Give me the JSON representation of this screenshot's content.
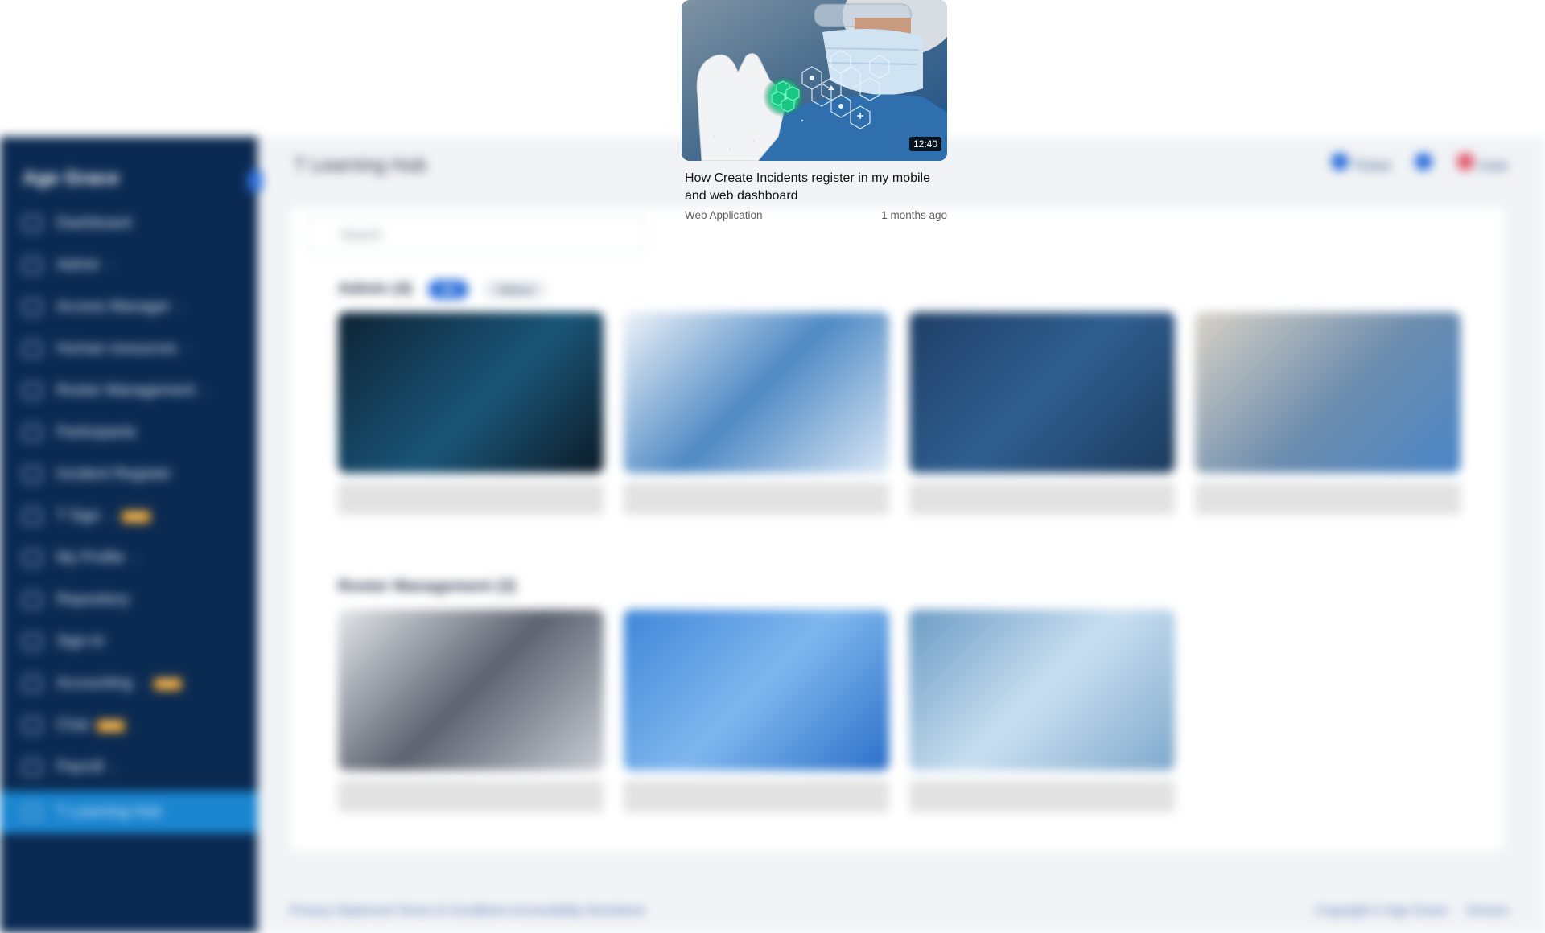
{
  "app": {
    "brand": "Age Grace",
    "collapse_icon": "chevron-left-icon",
    "page_title": "T Learning Hub",
    "top_actions": [
      "Ticket",
      "Notifications",
      "User"
    ],
    "search_placeholder": "Search"
  },
  "sidebar": {
    "items": [
      {
        "label": "Dashboard",
        "icon": "grid-icon",
        "chevron": false,
        "badge": ""
      },
      {
        "label": "Admin",
        "icon": "shield-icon",
        "chevron": true,
        "badge": ""
      },
      {
        "label": "Access Manager",
        "icon": "shield-icon",
        "chevron": true,
        "badge": ""
      },
      {
        "label": "Human resources",
        "icon": "folder-icon",
        "chevron": true,
        "badge": ""
      },
      {
        "label": "Roster Management",
        "icon": "calendar-icon",
        "chevron": true,
        "badge": ""
      },
      {
        "label": "Participants",
        "icon": "people-icon",
        "chevron": false,
        "badge": ""
      },
      {
        "label": "Incident Register",
        "icon": "user-alert-icon",
        "chevron": false,
        "badge": ""
      },
      {
        "label": "T Sign",
        "icon": "signature-icon",
        "chevron": true,
        "badge": "NEW"
      },
      {
        "label": "My Profile",
        "icon": "person-icon",
        "chevron": true,
        "badge": ""
      },
      {
        "label": "Repository",
        "icon": "database-icon",
        "chevron": false,
        "badge": ""
      },
      {
        "label": "Sign-In",
        "icon": "key-icon",
        "chevron": false,
        "badge": ""
      },
      {
        "label": "Accounting",
        "icon": "ledger-icon",
        "chevron": true,
        "badge": "NEW"
      },
      {
        "label": "Chat",
        "icon": "chat-icon",
        "chevron": false,
        "badge": "NEW"
      },
      {
        "label": "Payroll",
        "icon": "payroll-icon",
        "chevron": true,
        "badge": ""
      },
      {
        "label": "T Learning Hub",
        "icon": "learning-icon",
        "chevron": false,
        "badge": "",
        "active": true
      }
    ]
  },
  "sections": [
    {
      "title": "Admin (4)",
      "chips": [
        "All",
        "Videos"
      ]
    },
    {
      "title": "Roster Management (3)",
      "chips": []
    }
  ],
  "footer": {
    "left": "Privacy Statement  Terms & Conditions  Accessibility  Disclaimer",
    "right_1": "Copyright © Age Grace",
    "right_2": "Version"
  },
  "popup": {
    "duration": "12:40",
    "title": "How Create Incidents register in my mobile and web dashboard",
    "channel": "Web Application",
    "age": "1 months ago",
    "thumbnail_icon": "medical-tech-thumbnail",
    "colors": {
      "accent": "#1a86d0",
      "sidebar": "#0b2a52",
      "glow": "#1fd18a"
    }
  }
}
